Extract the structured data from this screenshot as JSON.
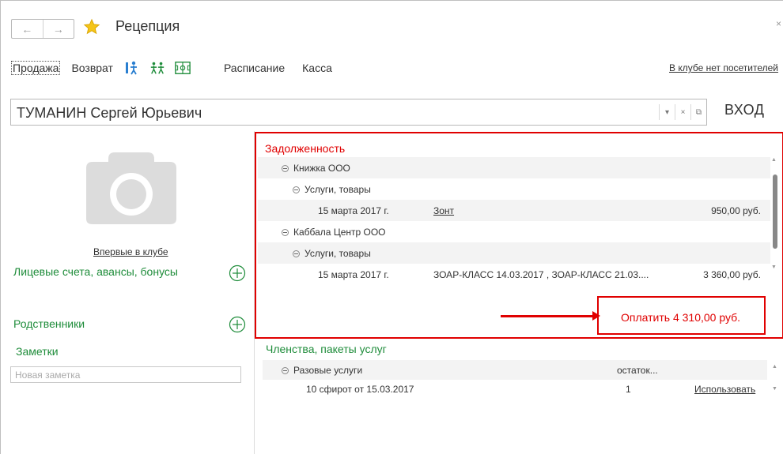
{
  "window": {
    "title": "Рецепция",
    "close_glyph": "×"
  },
  "nav": {
    "back": "←",
    "forward": "→"
  },
  "toolbar": {
    "sale": "Продажа",
    "return": "Возврат",
    "schedule": "Расписание",
    "cash": "Касса",
    "visitors_status": "В клубе нет посетителей",
    "icons": [
      "person-arrow-icon",
      "people-icon",
      "hall-layout-icon"
    ]
  },
  "client": {
    "name": "ТУМАНИН Сергей Юрьевич",
    "entry_label": "ВХОД",
    "field_buttons": [
      "▾",
      "×",
      "⧉"
    ]
  },
  "left": {
    "first_visit": "Впервые в клубе",
    "accounts_title": "Лицевые счета, авансы, бонусы",
    "relatives_title": "Родственники",
    "notes_title": "Заметки",
    "notes_placeholder": "Новая заметка"
  },
  "debt": {
    "title": "Задолженность",
    "rows": [
      {
        "level": 1,
        "label": "Книжка ООО"
      },
      {
        "level": 2,
        "label": "Услуги, товары"
      },
      {
        "level": 3,
        "date": "15 марта 2017 г.",
        "item": "Зонт",
        "sum": "950,00 руб."
      },
      {
        "level": 1,
        "label": "Каббала Центр ООО"
      },
      {
        "level": 2,
        "label": "Услуги, товары"
      },
      {
        "level": 3,
        "date": "15 марта 2017 г.",
        "item": "ЗОАР-КЛАСС 14.03.2017 , ЗОАР-КЛАСС 21.03....",
        "sum": "3 360,00 руб."
      }
    ],
    "pay_label": "Оплатить 4 310,00 руб."
  },
  "memberships": {
    "title": "Членства, пакеты услуг",
    "group": "Разовые услуги",
    "rest_header": "остаток...",
    "row": {
      "name": "10 сфирот  от 15.03.2017",
      "qty": "1",
      "action": "Использовать"
    }
  },
  "colors": {
    "accent_red": "#e00000",
    "section_green": "#1e8c3a",
    "star_yellow": "#f5c518"
  }
}
